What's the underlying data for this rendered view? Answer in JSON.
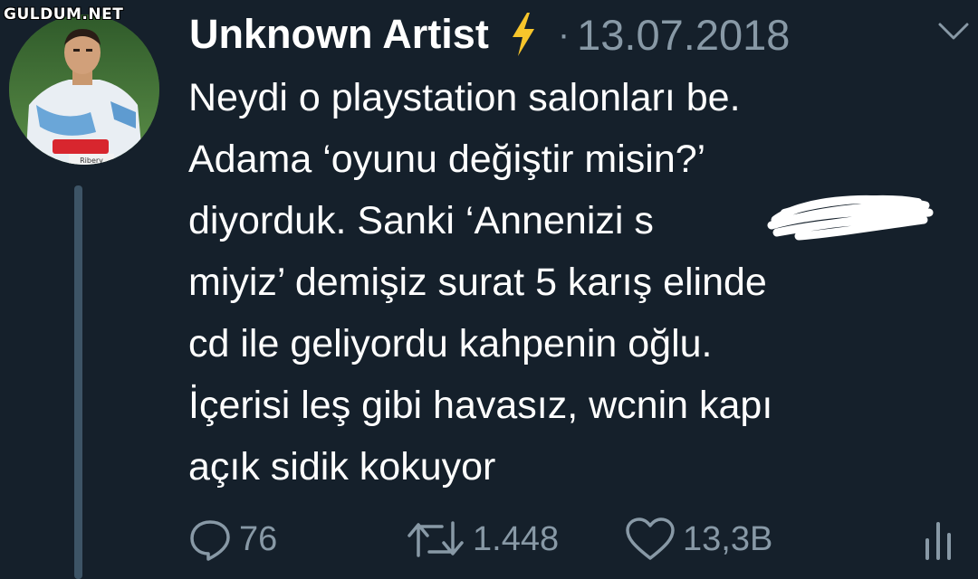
{
  "watermark": "GULDUM.NET",
  "tweet": {
    "author_name": "Unknown Artist",
    "separator": "·",
    "date": "13.07.2018",
    "text_lines": [
      "Neydi o playstation salonları be.",
      "Adama ‘oyunu değiştir misin?’",
      "diyorduk. Sanki ‘Annenizi  s",
      "miyiz’ demişiz surat 5 karış elinde",
      "cd ile geliyordu kahpenin oğlu.",
      "İçerisi leş gibi havasız, wcnin kapı",
      "açık sidik kokuyor"
    ],
    "jersey_name": "Ribery",
    "reply_count": "76",
    "retweet_count": "1.448",
    "like_count": "13,3B"
  },
  "icons": {
    "verified_emoji": "lightning-bolt-icon",
    "menu": "chevron-down-icon",
    "reply": "reply-icon",
    "retweet": "retweet-icon",
    "like": "heart-icon",
    "stats": "analytics-icon"
  },
  "colors": {
    "background": "#15202b",
    "text": "#ffffff",
    "secondary_text": "#8899a6",
    "bolt": "#f7c52b"
  }
}
